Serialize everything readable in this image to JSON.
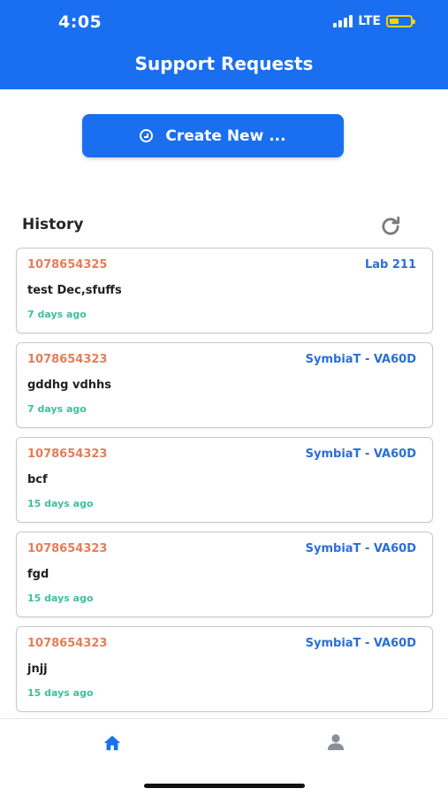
{
  "status_bar": {
    "time": "4:05",
    "network": "LTE",
    "battery_level": 0.45
  },
  "header": {
    "title": "Support Requests"
  },
  "actions": {
    "create_label": "Create New ...",
    "create_icon": "plus-circle-icon"
  },
  "history": {
    "label": "History",
    "refresh_icon": "refresh-icon"
  },
  "requests": [
    {
      "id": "1078654325",
      "device": "Lab 211",
      "text": "test Dec,sfuffs",
      "time": "7 days ago"
    },
    {
      "id": "1078654323",
      "device": "SymbiaT - VA60D",
      "text": "gddhg vdhhs",
      "time": "7 days ago"
    },
    {
      "id": "1078654323",
      "device": "SymbiaT - VA60D",
      "text": "bcf",
      "time": "15 days ago"
    },
    {
      "id": "1078654323",
      "device": "SymbiaT - VA60D",
      "text": "fgd",
      "time": "15 days ago"
    },
    {
      "id": "1078654323",
      "device": "SymbiaT - VA60D",
      "text": "jnjj",
      "time": "15 days ago"
    }
  ],
  "bottom_nav": {
    "items": [
      {
        "icon": "home-icon"
      },
      {
        "icon": "user-icon"
      }
    ]
  },
  "colors": {
    "primary": "#1a6ff0",
    "id": "#e37e57",
    "device": "#2a6fd6",
    "time": "#3fbf9a",
    "battery": "#ffd200"
  }
}
